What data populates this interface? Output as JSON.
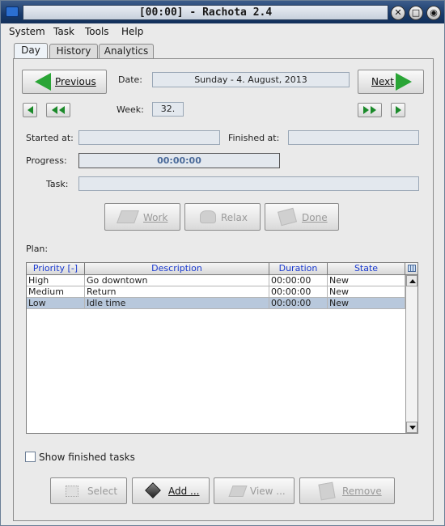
{
  "window": {
    "title": "[00:00] - Rachota 2.4"
  },
  "menubar": {
    "system": "System",
    "task": "Task",
    "tools": "Tools",
    "help": "Help"
  },
  "tabs": [
    {
      "label": "Day"
    },
    {
      "label": "History"
    },
    {
      "label": "Analytics"
    }
  ],
  "day": {
    "previous_label": "Previous",
    "next_label": "Next",
    "date_label": "Date:",
    "date_value": "Sunday - 4. August, 2013",
    "week_label": "Week:",
    "week_value": "32.",
    "started_label": "Started at:",
    "started_value": "",
    "finished_label": "Finished at:",
    "finished_value": "",
    "progress_label": "Progress:",
    "progress_value": "00:00:00",
    "task_label": "Task:",
    "task_value": "",
    "work_label": "Work",
    "relax_label": "Relax",
    "done_label": "Done",
    "plan_label": "Plan:",
    "show_finished_label": "Show finished tasks",
    "select_label": "Select",
    "add_label": "Add ...",
    "view_label": "View ...",
    "remove_label": "Remove"
  },
  "plan": {
    "columns": [
      "Priority [-]",
      "Description",
      "Duration",
      "State"
    ],
    "rows": [
      {
        "priority": "High",
        "description": "Go downtown",
        "duration": "00:00:00",
        "state": "New"
      },
      {
        "priority": "Medium",
        "description": "Return",
        "duration": "00:00:00",
        "state": "New"
      },
      {
        "priority": "Low",
        "description": "Idle time",
        "duration": "00:00:00",
        "state": "New"
      }
    ]
  },
  "colors": {
    "accent_green": "#2aa536",
    "header_text": "#1a3ad0",
    "selected_row": "#b8c8dc"
  }
}
